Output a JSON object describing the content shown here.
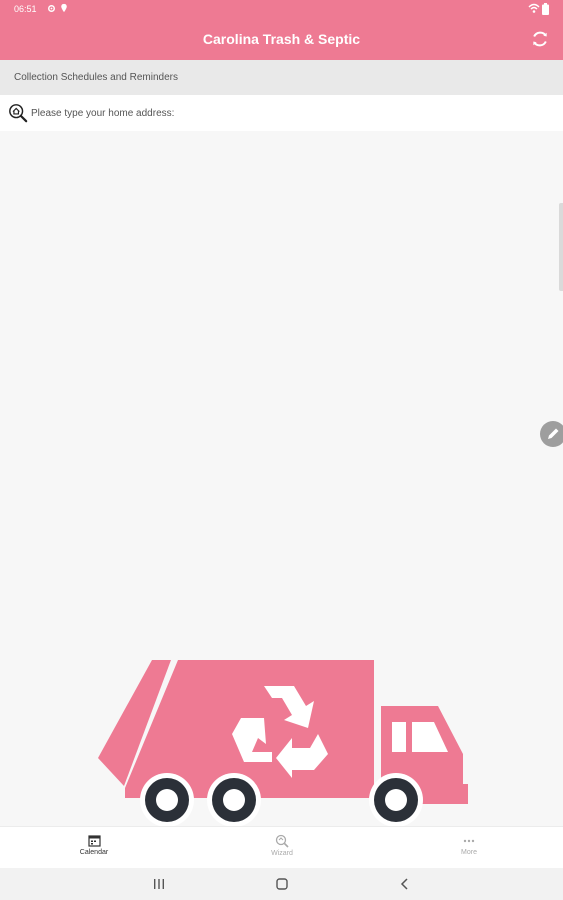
{
  "status_bar": {
    "time": "06:51",
    "icons_left": [
      "gear-icon",
      "location-icon"
    ],
    "icons_right": [
      "wifi-icon",
      "battery-icon"
    ]
  },
  "app_bar": {
    "title": "Carolina Trash & Septic",
    "action_icon": "refresh-icon",
    "color": "#ee7a93"
  },
  "subheader": {
    "text": "Collection Schedules and Reminders"
  },
  "address_search": {
    "icon": "home-search-icon",
    "placeholder": "Please type your home address:",
    "value": ""
  },
  "fab": {
    "icon": "pencil-icon"
  },
  "illustration": {
    "name": "garbage-truck-recycle",
    "color": "#ee7a93",
    "wheel_color": "#2b3038"
  },
  "bottom_nav": {
    "items": [
      {
        "label": "Calendar",
        "icon": "calendar-icon",
        "active": true
      },
      {
        "label": "Wizard",
        "icon": "wizard-search-icon",
        "active": false
      },
      {
        "label": "More",
        "icon": "more-icon",
        "active": false
      }
    ]
  },
  "system_nav": {
    "buttons": [
      "recents-button",
      "home-button",
      "back-button"
    ]
  }
}
